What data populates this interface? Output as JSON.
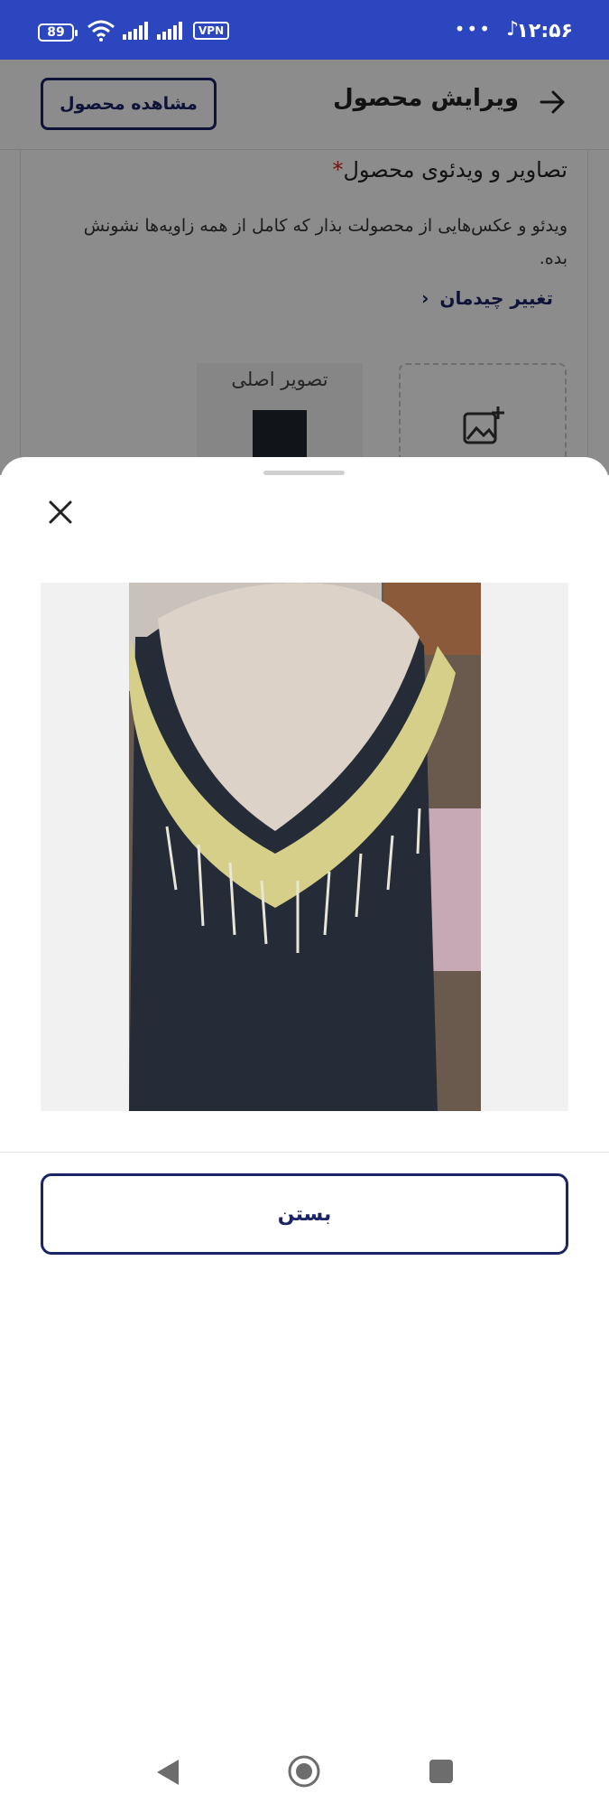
{
  "status_bar": {
    "time": "۱۲:۵۶",
    "battery": "89",
    "vpn": "VPN",
    "more": "•••"
  },
  "header": {
    "title": "ویرایش محصول",
    "view_product_button": "مشاهده محصول"
  },
  "media_section": {
    "title": "تصاویر و ویدئوی محصول",
    "required_mark": "*",
    "description": "ویدئو و عکس‌هایی از محصولت بذار که کامل از همه زاویه‌ها نشونش بده.",
    "change_layout_link": "تغییر چیدمان",
    "main_image_label": "تصویر اصلی"
  },
  "preview_sheet": {
    "close_button": "بستن"
  },
  "colors": {
    "status_bar": "#2b46bf",
    "accent": "#1c2468",
    "required": "#d32020"
  }
}
